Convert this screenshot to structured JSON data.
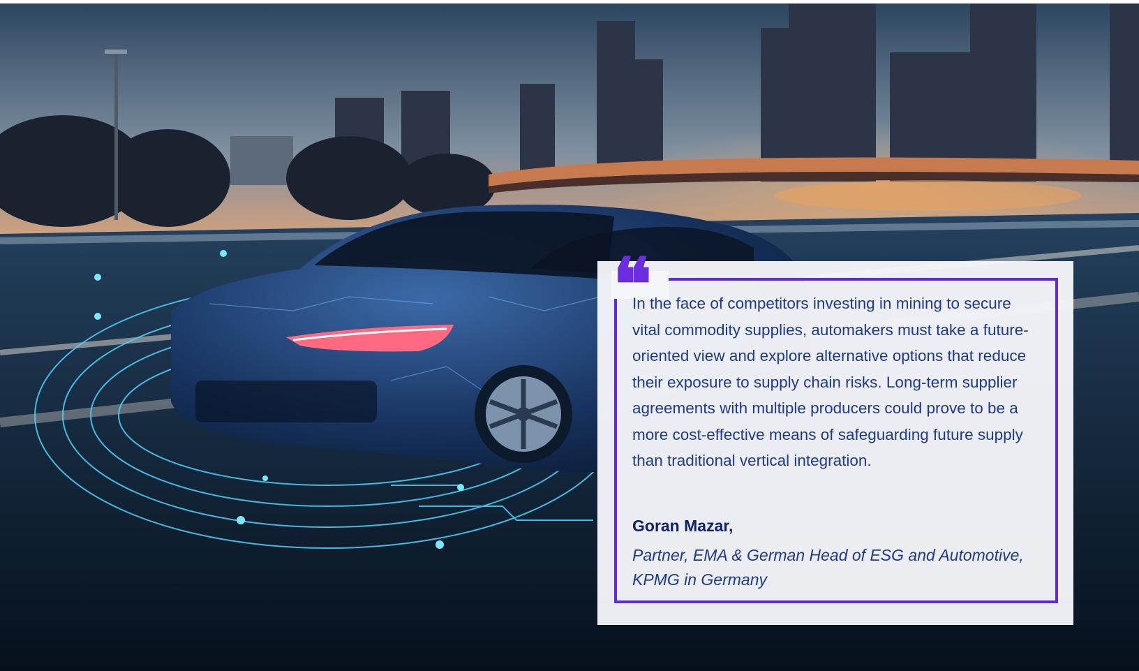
{
  "hero": {
    "image": "futuristic-car-city-highway-photo"
  },
  "quote": {
    "icon": "quote-mark-icon",
    "glyph": "❝",
    "text": "In the face of competitors investing in mining to secure vital commodity supplies, automakers must take a future-oriented view and explore alternative options that reduce their exposure to supply chain risks. Long-term supplier agreements with multiple producers could prove to be a more cost-effective means of safeguarding future supply than traditional vertical integration.",
    "author": "Goran Mazar,",
    "role": "Partner, EMA & German Head of ESG and Automotive, KPMG in Germany"
  },
  "colors": {
    "accent": "#5f2bd9",
    "text": "#1e3a8a",
    "author": "#10226f",
    "card": "#f5f6fa"
  }
}
